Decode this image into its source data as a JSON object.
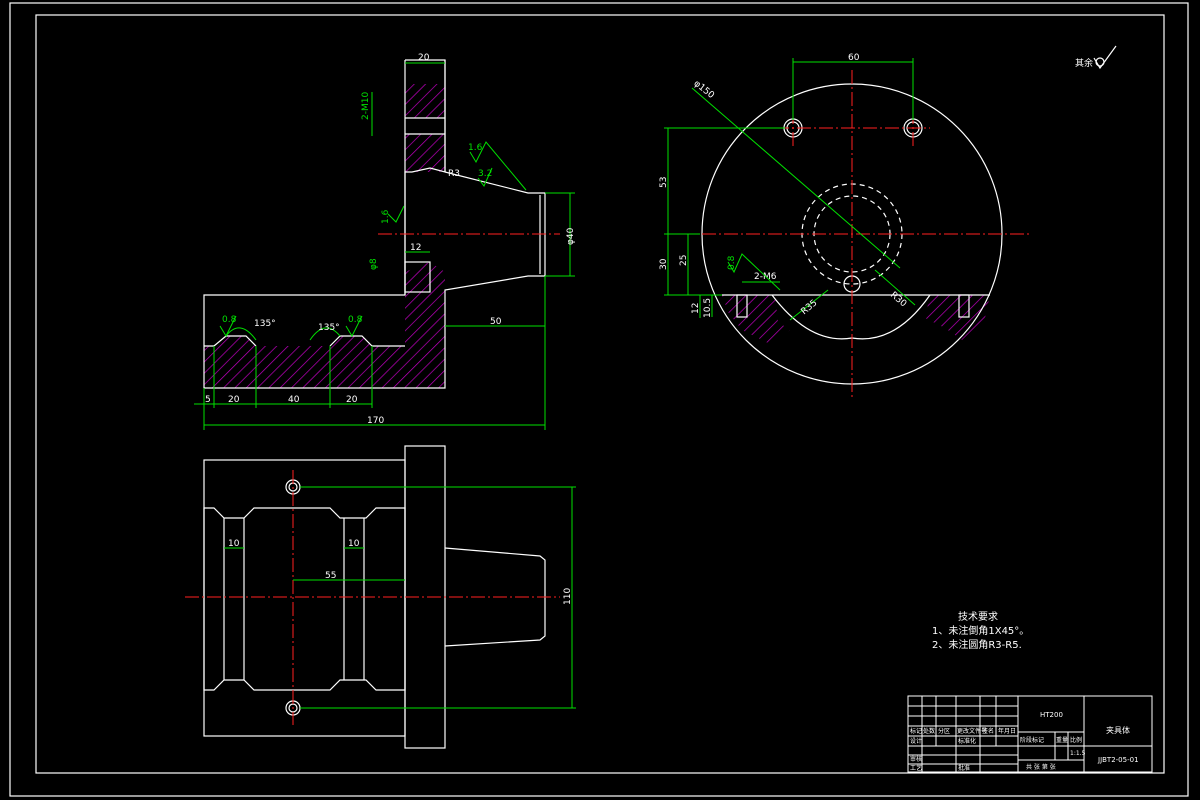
{
  "dimensions": {
    "front": {
      "flange_width": "20",
      "top_thread": "2-M10",
      "cone_diameter": "φ40",
      "hole_width": "12",
      "hole_depth": "φ8",
      "length_50": "50",
      "length_170": "170",
      "seg_5": "5",
      "seg_20a": "20",
      "seg_40": "40",
      "seg_20b": "20",
      "angle_a": "135°",
      "angle_b": "135°",
      "radius_r3": "R3",
      "rough_08a": "0.8",
      "rough_08b": "0.8",
      "rough_16a": "1.6",
      "rough_16b": "1.6",
      "rough_32": "3.2"
    },
    "side": {
      "hole_spacing": "60",
      "outer_diameter": "φ150",
      "height_53": "53",
      "height_30": "30",
      "height_25": "25",
      "height_12": "12",
      "height_105": "10.5",
      "thread": "2-M6",
      "r35": "R35",
      "r30": "R30",
      "rough_08": "0.8"
    },
    "top": {
      "slot_a": "10",
      "slot_b": "10",
      "offset_55": "55",
      "height_110": "110"
    }
  },
  "surface_mark": "其余",
  "tech_requirements": {
    "title": "技术要求",
    "line1": "1、未注倒角1X45°。",
    "line2": "2、未注圆角R3-R5."
  },
  "title_block": {
    "material": "HT200",
    "part_name": "夹具体",
    "drawing_no": "JJBT2-05-01",
    "scale": "1:1.5",
    "row_labels": [
      "标记",
      "设计",
      "审核",
      "工艺"
    ],
    "col_labels": [
      "处数",
      "分区",
      "更改文件号",
      "签名",
      "年月日"
    ],
    "stage_label": "阶段标记",
    "weight_label": "重量",
    "scale_label": "比例",
    "approve_label": "批准",
    "sheet_label": "共 张 第 张",
    "std_label": "标准化"
  }
}
